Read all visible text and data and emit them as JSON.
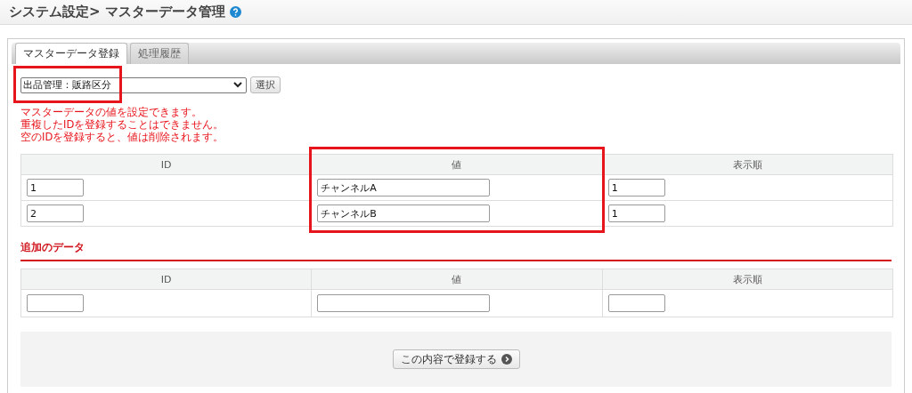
{
  "page_title": "システム設定> マスターデータ管理",
  "tabs": [
    {
      "label": "マスターデータ登録",
      "selected": true
    },
    {
      "label": "処理履歴",
      "selected": false
    }
  ],
  "master_select": {
    "value": "出品管理：販路区分",
    "highlighted": true
  },
  "select_button": "選択",
  "notes": [
    "マスターデータの値を設定できます。",
    "重複したIDを登録することはできません。",
    "空のIDを登録すると、値は削除されます。"
  ],
  "table": {
    "columns": [
      {
        "label": "ID",
        "highlighted": false
      },
      {
        "label": "値",
        "highlighted": true
      },
      {
        "label": "表示順",
        "highlighted": false
      }
    ],
    "rows": [
      [
        "1",
        "チャンネルA",
        "1"
      ],
      [
        "2",
        "チャンネルB",
        "1"
      ]
    ]
  },
  "additional_section": {
    "title": "追加のデータ",
    "columns": [
      "ID",
      "値",
      "表示順"
    ]
  },
  "submit_button": "この内容で登録する"
}
